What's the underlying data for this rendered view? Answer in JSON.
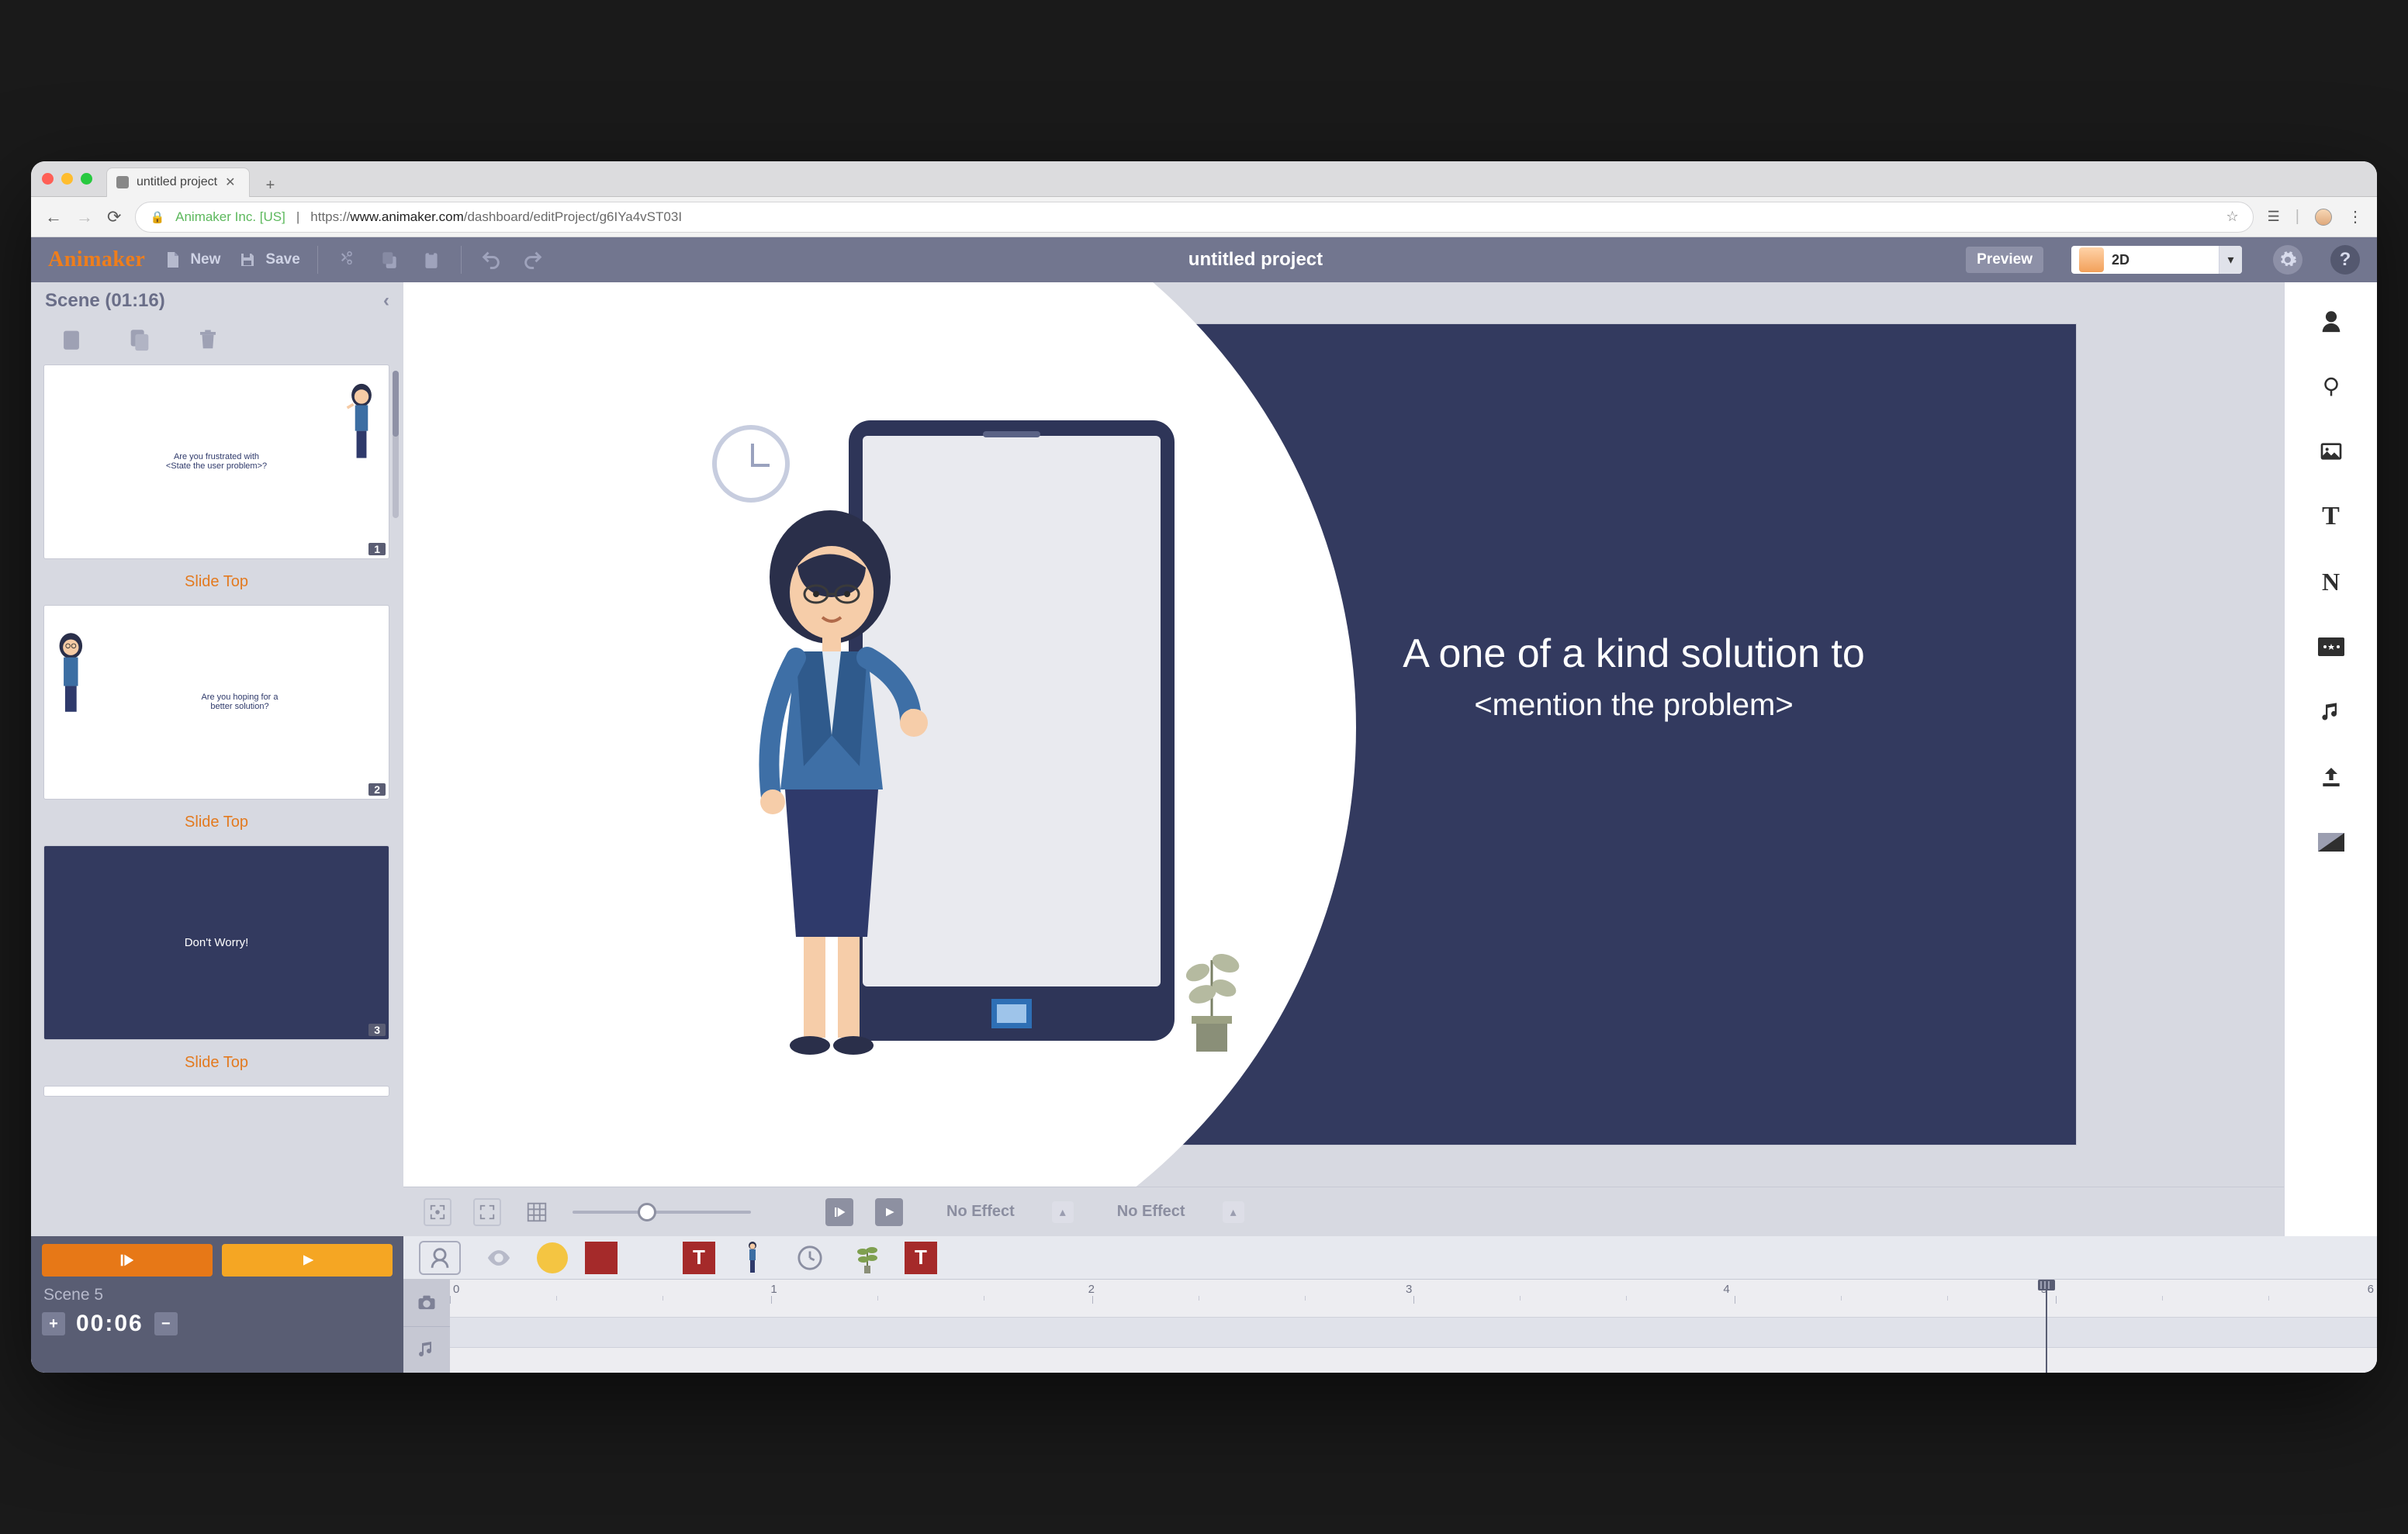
{
  "browser": {
    "tab_title": "untitled project",
    "secure_label": "Animaker Inc. [US]",
    "url_prefix": "https://",
    "url_host": "www.animaker.com",
    "url_path": "/dashboard/editProject/g6IYa4vST03I"
  },
  "appbar": {
    "brand": "Animaker",
    "new_label": "New",
    "save_label": "Save",
    "project_title": "untitled project",
    "preview_label": "Preview",
    "mode_label": "2D"
  },
  "scenes": {
    "header": "Scene  (01:16)",
    "slide1_line1": "Are you frustrated with",
    "slide1_line2": "<State the user problem>?",
    "slide2_line1": "Are you hoping for a",
    "slide2_line2": "better solution?",
    "slide3_line1": "Don't Worry!",
    "slide_cap": "Slide Top",
    "num1": "1",
    "num2": "2",
    "num3": "3"
  },
  "canvas": {
    "line1": "A one of a kind solution to",
    "line2": "<mention the problem>",
    "effect_in": "No Effect",
    "effect_out": "No Effect"
  },
  "rail": {
    "text_icon": "T",
    "number_icon": "N"
  },
  "timeline": {
    "scene_label": "Scene 5",
    "timecode": "00:06",
    "asset_text": "T",
    "ruler": [
      "0",
      "1",
      "2",
      "3",
      "4",
      "5",
      "6"
    ],
    "playhead_pct": 82.8
  }
}
